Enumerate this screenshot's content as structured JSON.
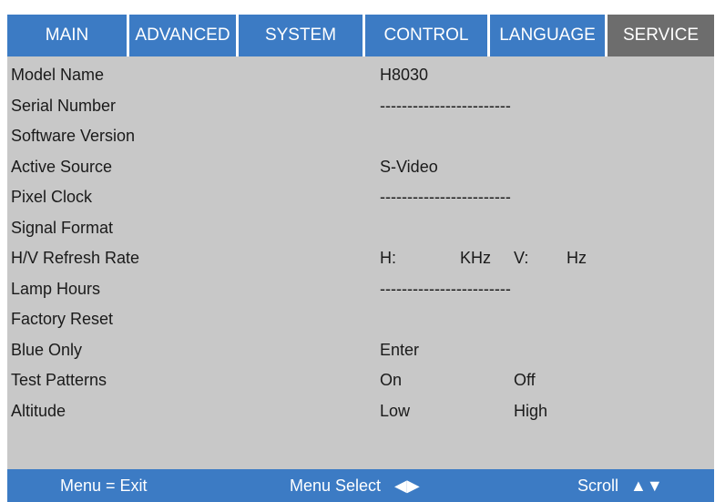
{
  "tabs": [
    {
      "label": "MAIN",
      "active": false
    },
    {
      "label": "ADVANCED",
      "active": false
    },
    {
      "label": "SYSTEM",
      "active": false
    },
    {
      "label": "CONTROL",
      "active": false
    },
    {
      "label": "LANGUAGE",
      "active": false
    },
    {
      "label": "SERVICE",
      "active": true
    }
  ],
  "rows": [
    {
      "label": "Model Name",
      "value": "H8030"
    },
    {
      "label": "Serial Number",
      "value": "------------------------"
    },
    {
      "label": "Software Version",
      "value": ""
    },
    {
      "label": "Active Source",
      "value": "S-Video"
    },
    {
      "label": "Pixel Clock",
      "value": "------------------------"
    },
    {
      "label": "Signal Format",
      "value": ""
    },
    {
      "label": "H/V Refresh Rate",
      "h_label": "H:",
      "h_unit": "KHz",
      "v_label": "V:",
      "v_unit": "Hz"
    },
    {
      "label": "Lamp Hours",
      "value": "------------------------"
    },
    {
      "label": "Factory Reset",
      "value": ""
    },
    {
      "label": "Blue Only",
      "value": "Enter"
    },
    {
      "label": "Test Patterns",
      "option1": "On",
      "option2": "Off"
    },
    {
      "label": "Altitude",
      "option1": "Low",
      "option2": "High"
    }
  ],
  "footer": {
    "exit": "Menu = Exit",
    "select": "Menu Select",
    "select_arrows": "◀▶",
    "scroll": "Scroll",
    "scroll_arrows": "▲▼"
  },
  "colors": {
    "tab": "#3c7bc4",
    "tab_active": "#6d6d6d",
    "panel": "#c8c8c8",
    "footer": "#3c7bc4"
  }
}
